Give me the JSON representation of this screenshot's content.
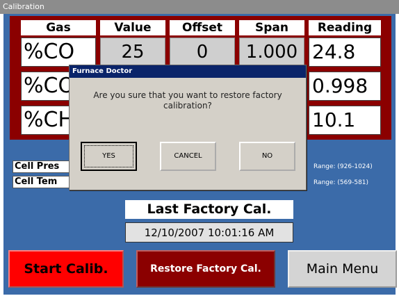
{
  "window": {
    "title": "Calibration"
  },
  "table": {
    "headers": [
      "Gas",
      "Value",
      "Offset",
      "Span",
      "Reading"
    ],
    "rows": [
      {
        "gas": "%CO",
        "value": "25",
        "offset": "0",
        "span": "1.000",
        "reading": "24.8"
      },
      {
        "gas": "%CO",
        "value": "",
        "offset": "",
        "span": "",
        "reading": "0.998"
      },
      {
        "gas": "%CH",
        "value": "",
        "offset": "",
        "span": "",
        "reading": "10.1"
      }
    ]
  },
  "cell_pressure": {
    "label": "Cell Pres",
    "range": "Range:  (926-1024)"
  },
  "cell_temperature": {
    "label": "Cell Tem",
    "range": "Range:  (569-581)"
  },
  "last_factory": {
    "title": "Last Factory Cal.",
    "date": "12/10/2007 10:01:16 AM"
  },
  "buttons": {
    "start": "Start Calib.",
    "restore": "Restore Factory Cal.",
    "main_menu": "Main Menu"
  },
  "dialog": {
    "title": "Furnace Doctor",
    "message": "Are you sure that you want to restore factory calibration?",
    "yes": "YES",
    "cancel": "CANCEL",
    "no": "NO"
  },
  "colors": {
    "background": "#3b6ba9",
    "table_frame": "#8b0000",
    "start_button": "#ff0000",
    "restore_button": "#8b0000",
    "dialog_title": "#0a246a"
  }
}
